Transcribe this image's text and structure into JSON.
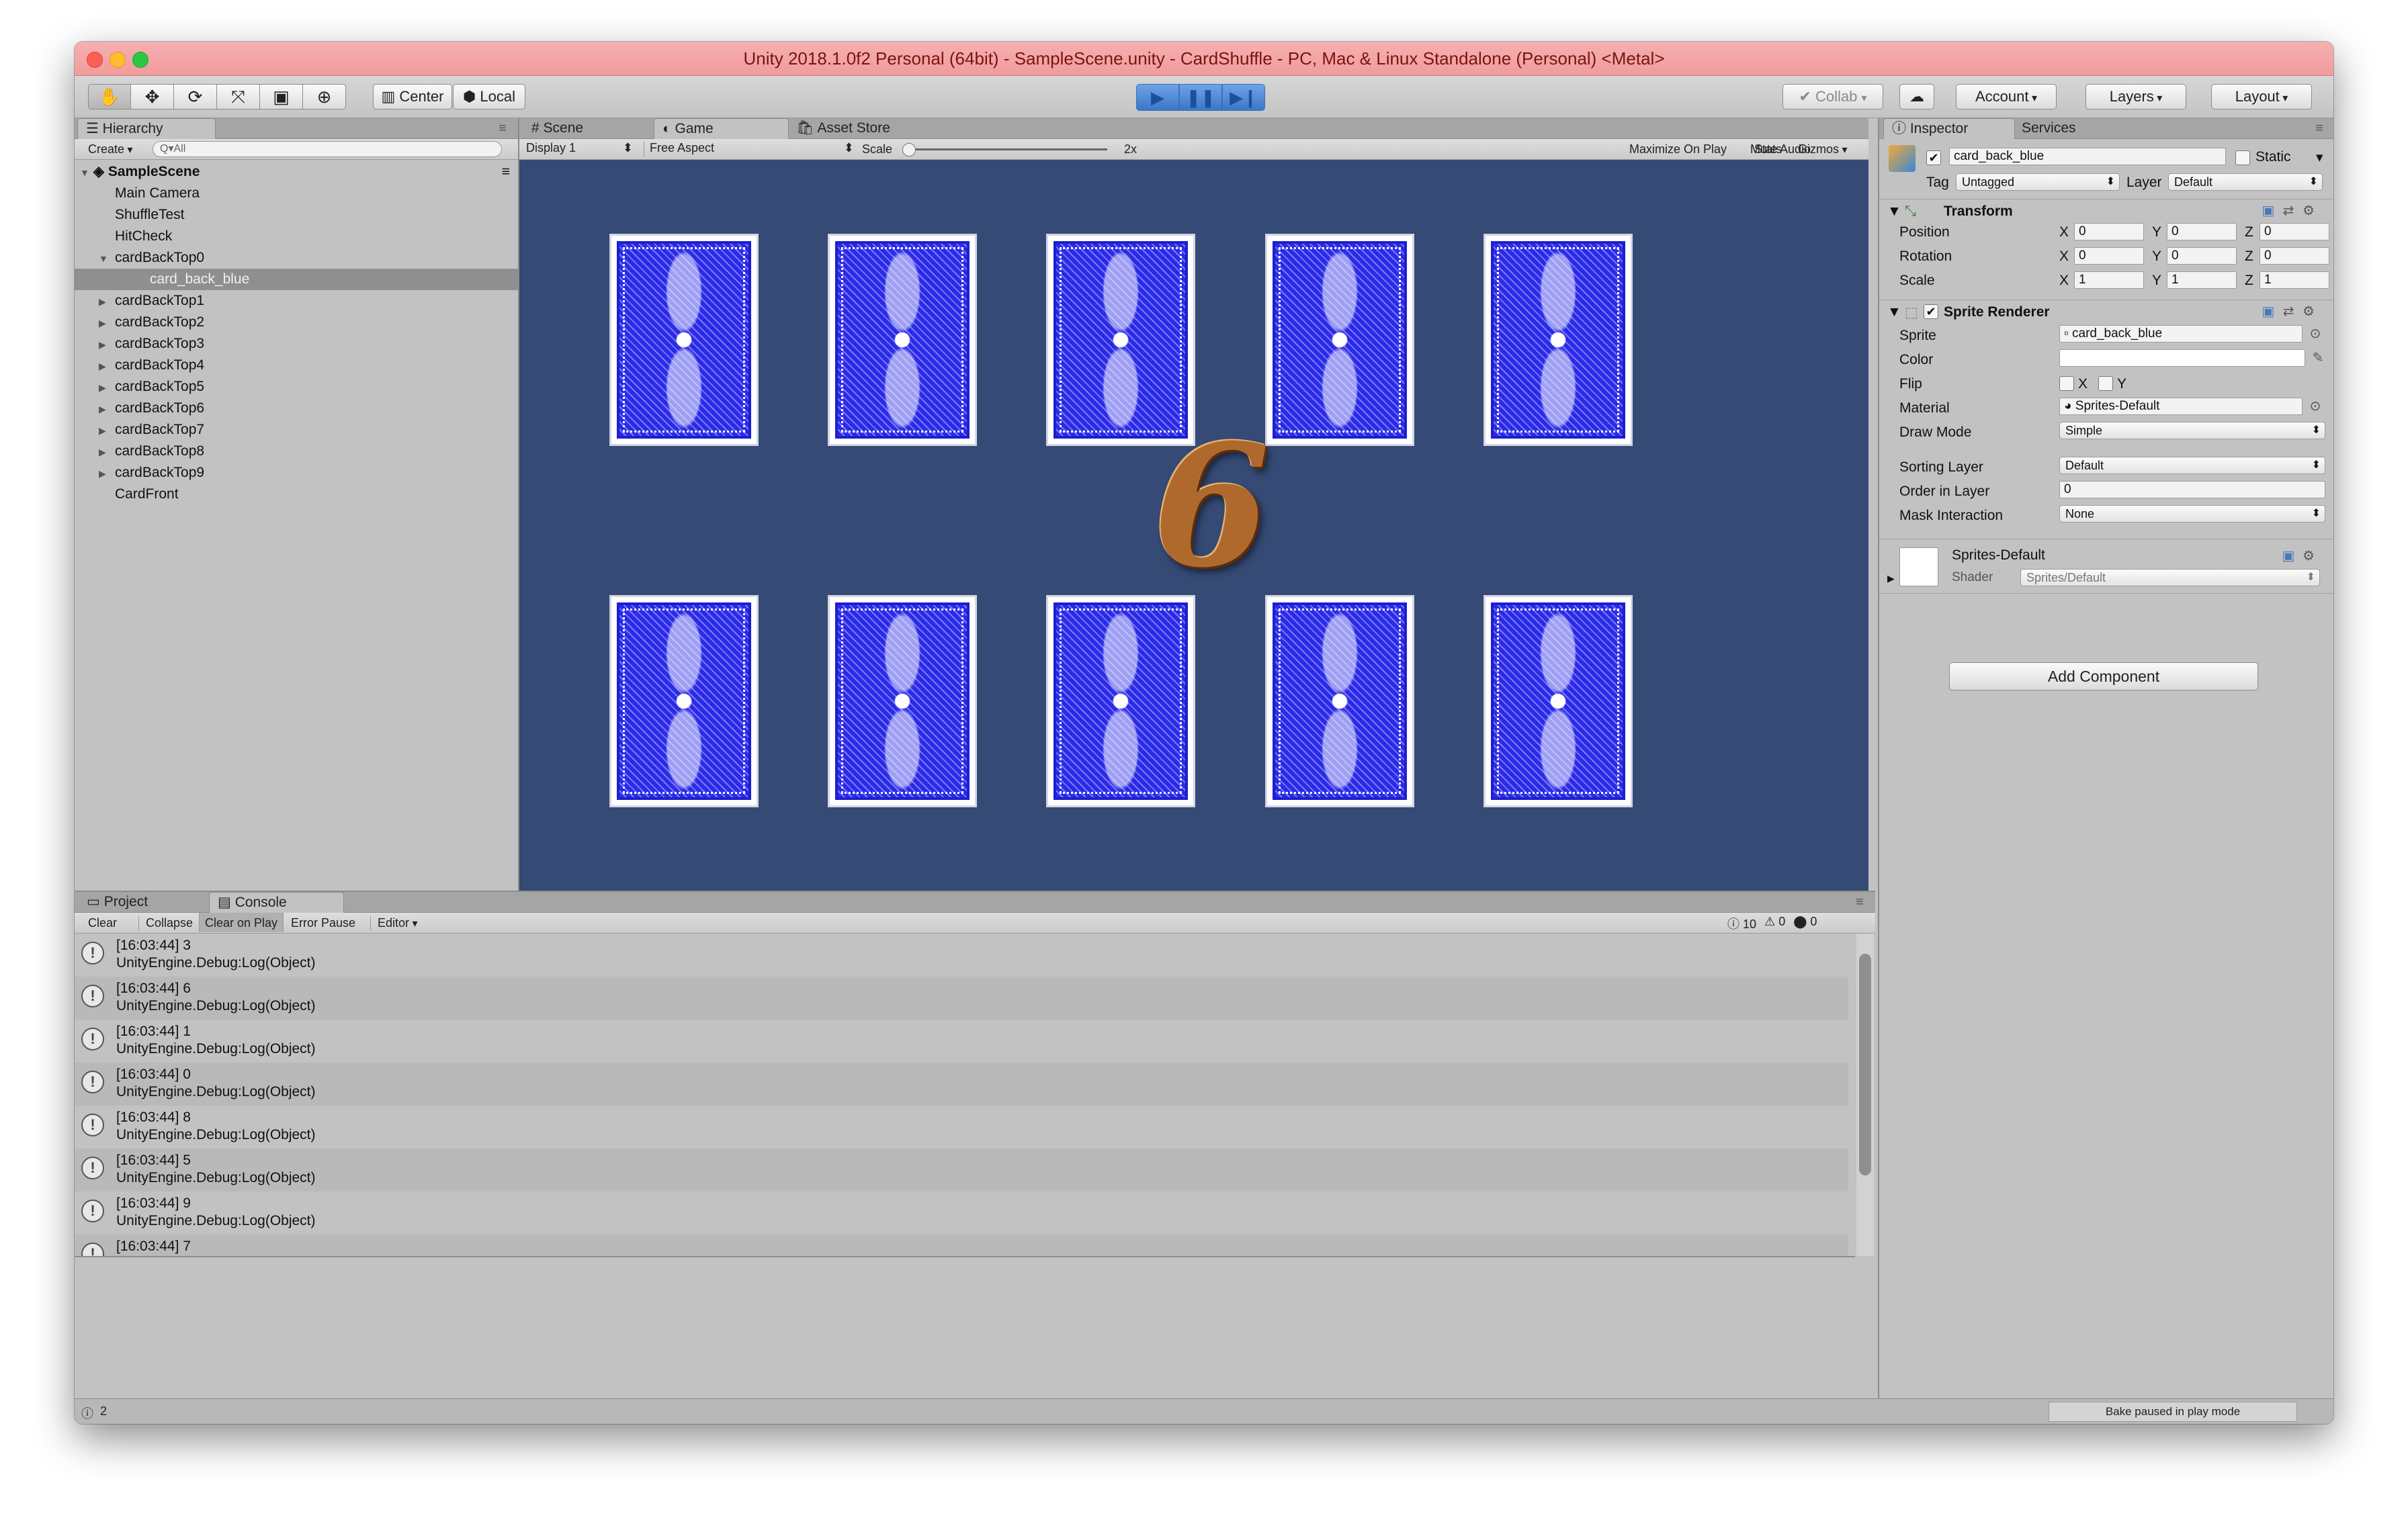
{
  "window": {
    "title": "Unity 2018.1.0f2 Personal (64bit) - SampleScene.unity - CardShuffle - PC, Mac & Linux Standalone (Personal) <Metal>"
  },
  "toolbar": {
    "center": "Center",
    "local": "Local",
    "collab": "Collab",
    "account": "Account",
    "layers": "Layers",
    "layout": "Layout"
  },
  "hierarchy": {
    "tab": "Hierarchy",
    "create": "Create",
    "search_placeholder": "Q▾All",
    "scene": "SampleScene",
    "items": [
      {
        "label": "Main Camera"
      },
      {
        "label": "ShuffleTest"
      },
      {
        "label": "HitCheck"
      },
      {
        "label": "cardBackTop0"
      },
      {
        "label": "card_back_blue"
      },
      {
        "label": "cardBackTop1"
      },
      {
        "label": "cardBackTop2"
      },
      {
        "label": "cardBackTop3"
      },
      {
        "label": "cardBackTop4"
      },
      {
        "label": "cardBackTop5"
      },
      {
        "label": "cardBackTop6"
      },
      {
        "label": "cardBackTop7"
      },
      {
        "label": "cardBackTop8"
      },
      {
        "label": "cardBackTop9"
      },
      {
        "label": "CardFront"
      }
    ]
  },
  "game": {
    "tabs": [
      "Scene",
      "Game",
      "Asset Store"
    ],
    "display": "Display 1",
    "aspect": "Free Aspect",
    "scale_label": "Scale",
    "scale_value": "2x",
    "maximize": "Maximize On Play",
    "mute": "Mute Audio",
    "stats": "Stats",
    "gizmos": "Gizmos",
    "shown_number": "6",
    "background_color": "#354a74",
    "card_color": "#2424e0"
  },
  "console": {
    "tabs": [
      "Project",
      "Console"
    ],
    "buttons": [
      "Clear",
      "Collapse",
      "Clear on Play",
      "Error Pause",
      "Editor"
    ],
    "count_log": "10",
    "count_warn": "0",
    "count_error": "0",
    "logs": [
      {
        "time": "[16:03:44] 3",
        "detail": "UnityEngine.Debug:Log(Object)"
      },
      {
        "time": "[16:03:44] 6",
        "detail": "UnityEngine.Debug:Log(Object)"
      },
      {
        "time": "[16:03:44] 1",
        "detail": "UnityEngine.Debug:Log(Object)"
      },
      {
        "time": "[16:03:44] 0",
        "detail": "UnityEngine.Debug:Log(Object)"
      },
      {
        "time": "[16:03:44] 8",
        "detail": "UnityEngine.Debug:Log(Object)"
      },
      {
        "time": "[16:03:44] 5",
        "detail": "UnityEngine.Debug:Log(Object)"
      },
      {
        "time": "[16:03:44] 9",
        "detail": "UnityEngine.Debug:Log(Object)"
      },
      {
        "time": "[16:03:44] 7",
        "detail": ""
      }
    ]
  },
  "inspector": {
    "tabs": [
      "Inspector",
      "Services"
    ],
    "object_name": "card_back_blue",
    "static": "Static",
    "tag_label": "Tag",
    "tag_value": "Untagged",
    "layer_label": "Layer",
    "layer_value": "Default",
    "transform": {
      "title": "Transform",
      "rows": [
        {
          "label": "Position",
          "x": "0",
          "y": "0",
          "z": "0"
        },
        {
          "label": "Rotation",
          "x": "0",
          "y": "0",
          "z": "0"
        },
        {
          "label": "Scale",
          "x": "1",
          "y": "1",
          "z": "1"
        }
      ]
    },
    "sprite_renderer": {
      "title": "Sprite Renderer",
      "sprite_label": "Sprite",
      "sprite_value": "card_back_blue",
      "color_label": "Color",
      "flip_label": "Flip",
      "flip_x": "X",
      "flip_y": "Y",
      "material_label": "Material",
      "material_value": "Sprites-Default",
      "draw_mode_label": "Draw Mode",
      "draw_mode_value": "Simple",
      "sorting_layer_label": "Sorting Layer",
      "sorting_layer_value": "Default",
      "order_label": "Order in Layer",
      "order_value": "0",
      "mask_label": "Mask Interaction",
      "mask_value": "None"
    },
    "material": {
      "name": "Sprites-Default",
      "shader_label": "Shader",
      "shader_value": "Sprites/Default"
    },
    "add_component": "Add Component"
  },
  "status": {
    "count": "2",
    "bake": "Bake paused in play mode"
  }
}
